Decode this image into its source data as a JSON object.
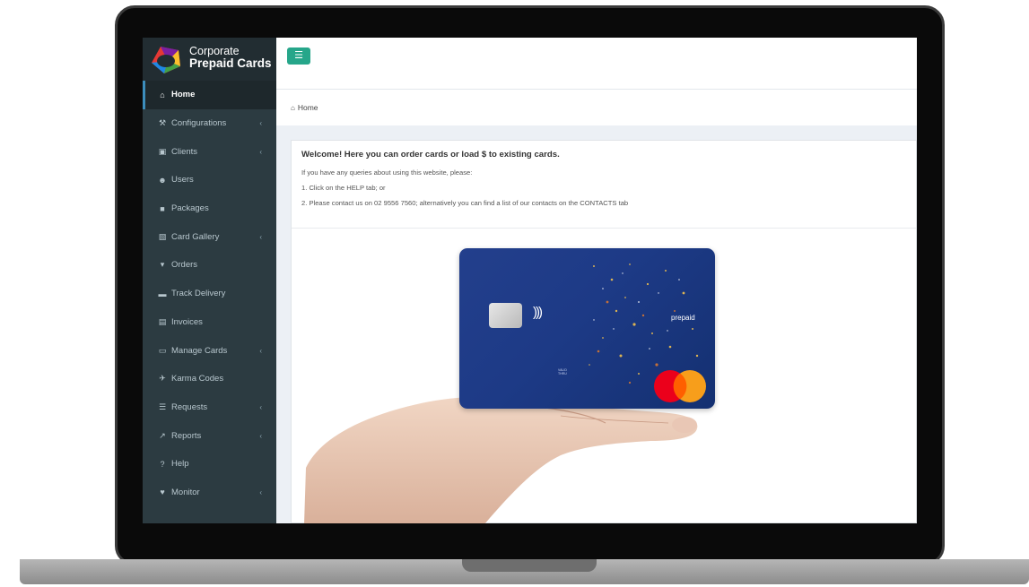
{
  "brand": {
    "logo_line1": "Corporate",
    "logo_line2": "Prepaid Cards",
    "accent": "#26a68a",
    "sidebar_bg": "#2c3b41"
  },
  "header": {
    "toggle_icon": "menu-icon"
  },
  "breadcrumb": {
    "icon": "home-icon",
    "label": "Home"
  },
  "sidebar": {
    "items": [
      {
        "label": "Home",
        "icon": "home-icon",
        "active": true,
        "expandable": false
      },
      {
        "label": "Configurations",
        "icon": "wrench-icon",
        "active": false,
        "expandable": true
      },
      {
        "label": "Clients",
        "icon": "bag-icon",
        "active": false,
        "expandable": true
      },
      {
        "label": "Users",
        "icon": "users-icon",
        "active": false,
        "expandable": false
      },
      {
        "label": "Packages",
        "icon": "gift-icon",
        "active": false,
        "expandable": false
      },
      {
        "label": "Card Gallery",
        "icon": "image-icon",
        "active": false,
        "expandable": true
      },
      {
        "label": "Orders",
        "icon": "cart-icon",
        "active": false,
        "expandable": false
      },
      {
        "label": "Track Delivery",
        "icon": "truck-icon",
        "active": false,
        "expandable": false
      },
      {
        "label": "Invoices",
        "icon": "file-icon",
        "active": false,
        "expandable": false
      },
      {
        "label": "Manage Cards",
        "icon": "credit-card-icon",
        "active": false,
        "expandable": true
      },
      {
        "label": "Karma Codes",
        "icon": "plane-icon",
        "active": false,
        "expandable": false
      },
      {
        "label": "Requests",
        "icon": "list-icon",
        "active": false,
        "expandable": true
      },
      {
        "label": "Reports",
        "icon": "chart-icon",
        "active": false,
        "expandable": true
      },
      {
        "label": "Help",
        "icon": "question-icon",
        "active": false,
        "expandable": false
      },
      {
        "label": "Monitor",
        "icon": "heartbeat-icon",
        "active": false,
        "expandable": true
      }
    ]
  },
  "main": {
    "welcome": "Welcome! Here you can order cards or load $ to existing cards.",
    "lines": [
      "If you have any queries about using this website, please:",
      "1. Click on the HELP tab; or",
      "2. Please contact us on 02 9556 7560; alternatively you can find a list of our contacts on the CONTACTS tab"
    ]
  },
  "card": {
    "brand": "prepaid",
    "valid_text": [
      "VALID",
      "THRU"
    ]
  }
}
